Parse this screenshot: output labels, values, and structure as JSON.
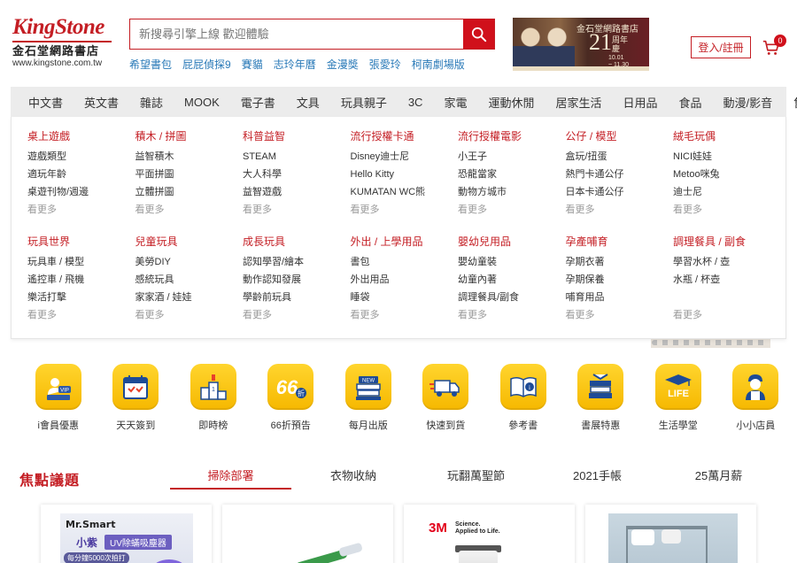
{
  "header": {
    "logo_brand": "KingStone",
    "logo_cn": "金石堂網路書店",
    "logo_url": "www.kingstone.com.tw",
    "search_placeholder": "新搜尋引擎上線 歡迎體驗",
    "hot_links": [
      "希望書包",
      "屁屁偵探9",
      "賽貓",
      "志玲年曆",
      "金漫獎",
      "張愛玲",
      "柯南劇場版"
    ],
    "banner": {
      "line1": "金石堂網路書店",
      "number": "21",
      "suffix": "周年慶",
      "date_from": "10.01",
      "date_to": "~ 11.30"
    },
    "login_label": "登入/註冊",
    "cart_count": "0",
    "cart_icon": "cart-icon",
    "search_icon": "search-icon"
  },
  "nav": [
    "中文書",
    "英文書",
    "雜誌",
    "MOOK",
    "電子書",
    "文具",
    "玩具親子",
    "3C",
    "家電",
    "運動休閒",
    "居家生活",
    "日用品",
    "食品",
    "動漫/影音",
    "售票"
  ],
  "mega_menu": {
    "more_label": "看更多",
    "rows": [
      [
        {
          "title": "桌上遊戲",
          "links": [
            "遊戲類型",
            "適玩年齡",
            "桌遊刊物/週邊"
          ]
        },
        {
          "title": "積木 / 拼圖",
          "links": [
            "益智積木",
            "平面拼圖",
            "立體拼圖"
          ]
        },
        {
          "title": "科普益智",
          "links": [
            "STEAM",
            "大人科學",
            "益智遊戲"
          ]
        },
        {
          "title": "流行授權卡通",
          "links": [
            "Disney迪士尼",
            "Hello Kitty",
            "KUMATAN WC熊"
          ]
        },
        {
          "title": "流行授權電影",
          "links": [
            "小王子",
            "恐龍當家",
            "動物方城市"
          ]
        },
        {
          "title": "公仔 / 模型",
          "links": [
            "盒玩/扭蛋",
            "熱門卡通公仔",
            "日本卡通公仔"
          ]
        },
        {
          "title": "絨毛玩偶",
          "links": [
            "NICI娃娃",
            "Metoo咪兔",
            "迪士尼"
          ]
        }
      ],
      [
        {
          "title": "玩具世界",
          "links": [
            "玩具車 / 模型",
            "遙控車 / 飛機",
            "樂活打擊"
          ]
        },
        {
          "title": "兒童玩具",
          "links": [
            "美勞DIY",
            "感統玩具",
            "家家酒 / 娃娃"
          ]
        },
        {
          "title": "成長玩具",
          "links": [
            "認知學習/繪本",
            "動作認知發展",
            "學齡前玩具"
          ]
        },
        {
          "title": "外出 / 上學用品",
          "links": [
            "書包",
            "外出用品",
            "睡袋"
          ]
        },
        {
          "title": "嬰幼兒用品",
          "links": [
            "嬰幼童裝",
            "幼童內著",
            "調理餐具/副食"
          ]
        },
        {
          "title": "孕產哺育",
          "links": [
            "孕期衣著",
            "孕期保養",
            "哺育用品"
          ]
        },
        {
          "title": "調理餐具 / 副食",
          "links": [
            "學習水杯 / 壺",
            "水瓶 / 杯壺"
          ]
        }
      ]
    ]
  },
  "quick_links": [
    {
      "label": "i會員優惠",
      "icon": "member-vip-icon",
      "icon_text": "VIP",
      "icon_sub": "i會員"
    },
    {
      "label": "天天簽到",
      "icon": "calendar-check-icon"
    },
    {
      "label": "即時榜",
      "icon": "podium-icon"
    },
    {
      "label": "66折預告",
      "icon": "discount-66-icon",
      "icon_text": "66",
      "icon_sub": "折"
    },
    {
      "label": "每月出版",
      "icon": "new-books-icon",
      "icon_text": "NEW"
    },
    {
      "label": "快速到貨",
      "icon": "fast-truck-icon"
    },
    {
      "label": "參考書",
      "icon": "reference-book-icon"
    },
    {
      "label": "書展特惠",
      "icon": "book-stack-icon"
    },
    {
      "label": "生活學堂",
      "icon": "life-school-icon",
      "icon_text": "LIFE"
    },
    {
      "label": "小小店員",
      "icon": "clerk-icon"
    }
  ],
  "focus": {
    "title": "焦點議題",
    "tabs": [
      "掃除部署",
      "衣物收納",
      "玩翻萬聖節",
      "2021手帳",
      "25萬月薪"
    ],
    "active_tab": "掃除部署"
  },
  "cards": [
    {
      "brand": "Mr.Smart",
      "name": "小紫",
      "tag": "UV除蟎吸塵器",
      "sub": "每分鐘5000次拍打"
    },
    {},
    {
      "brand": "3M",
      "tagline": "Science.\nApplied to Life."
    },
    {}
  ]
}
